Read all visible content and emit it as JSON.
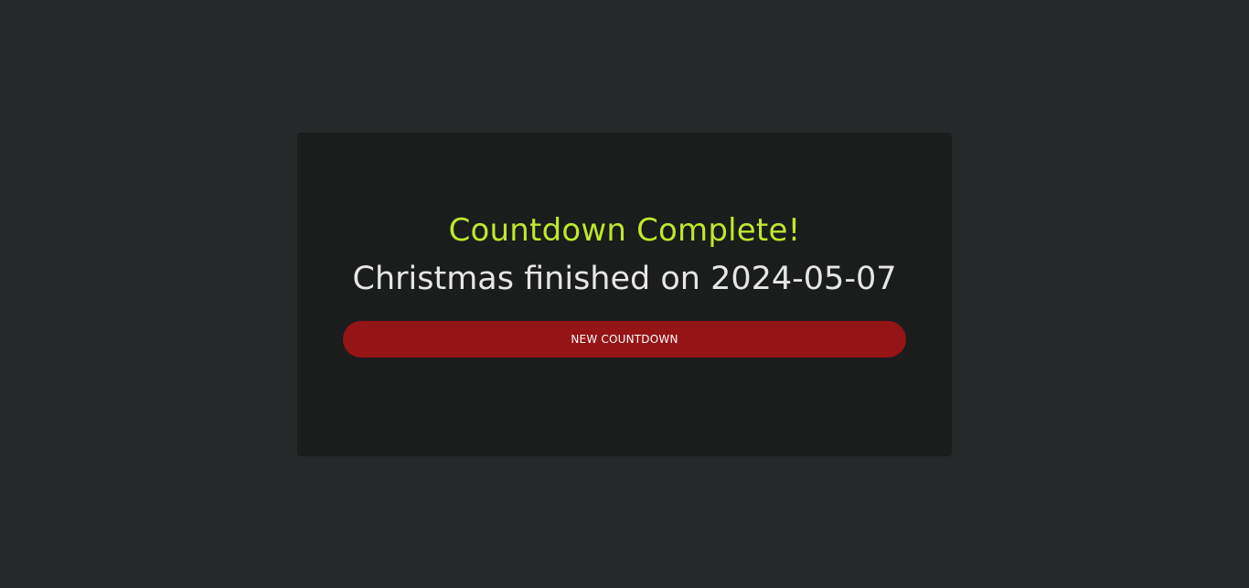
{
  "colors": {
    "page_background": "#262829",
    "card_background": "#1b1c1c",
    "title_color": "#bde82c",
    "subtitle_color": "#e6e6e6",
    "button_background": "#951416",
    "button_text": "#ffffff"
  },
  "result": {
    "title": "Countdown Complete!",
    "message": "Christmas finished on 2024-05-07"
  },
  "actions": {
    "new_countdown_label": "NEW COUNTDOWN"
  }
}
